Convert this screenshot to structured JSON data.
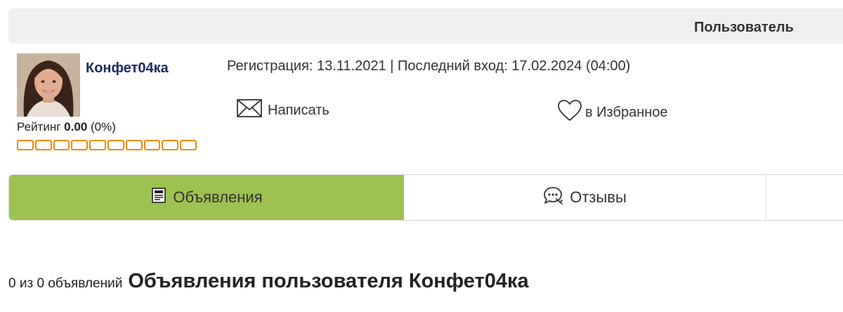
{
  "header": {
    "title": "Пользователь"
  },
  "profile": {
    "username": "Конфет04ка",
    "rating_label": "Рейтинг",
    "rating_value": "0.00",
    "rating_percent": "(0%)",
    "rating_level": 0,
    "rating_segments": 10,
    "registration": "Регистрация: 13.11.2021 | Последний вход: 17.02.2024 (04:00)"
  },
  "actions": {
    "write_label": "Написать",
    "favorite_label": "в Избранное"
  },
  "tabs": [
    {
      "label": "Объявления",
      "icon": "listing-icon",
      "active": true
    },
    {
      "label": "Отзывы",
      "icon": "reviews-icon",
      "active": false
    }
  ],
  "listings": {
    "count_text": "0 из 0 объявлений",
    "title": "Объявления пользователя Конфет04ка"
  },
  "colors": {
    "accent_green": "#9dc251",
    "rating_orange": "#f08a00",
    "username_blue": "#1c2a5e",
    "header_bg": "#efefef"
  }
}
